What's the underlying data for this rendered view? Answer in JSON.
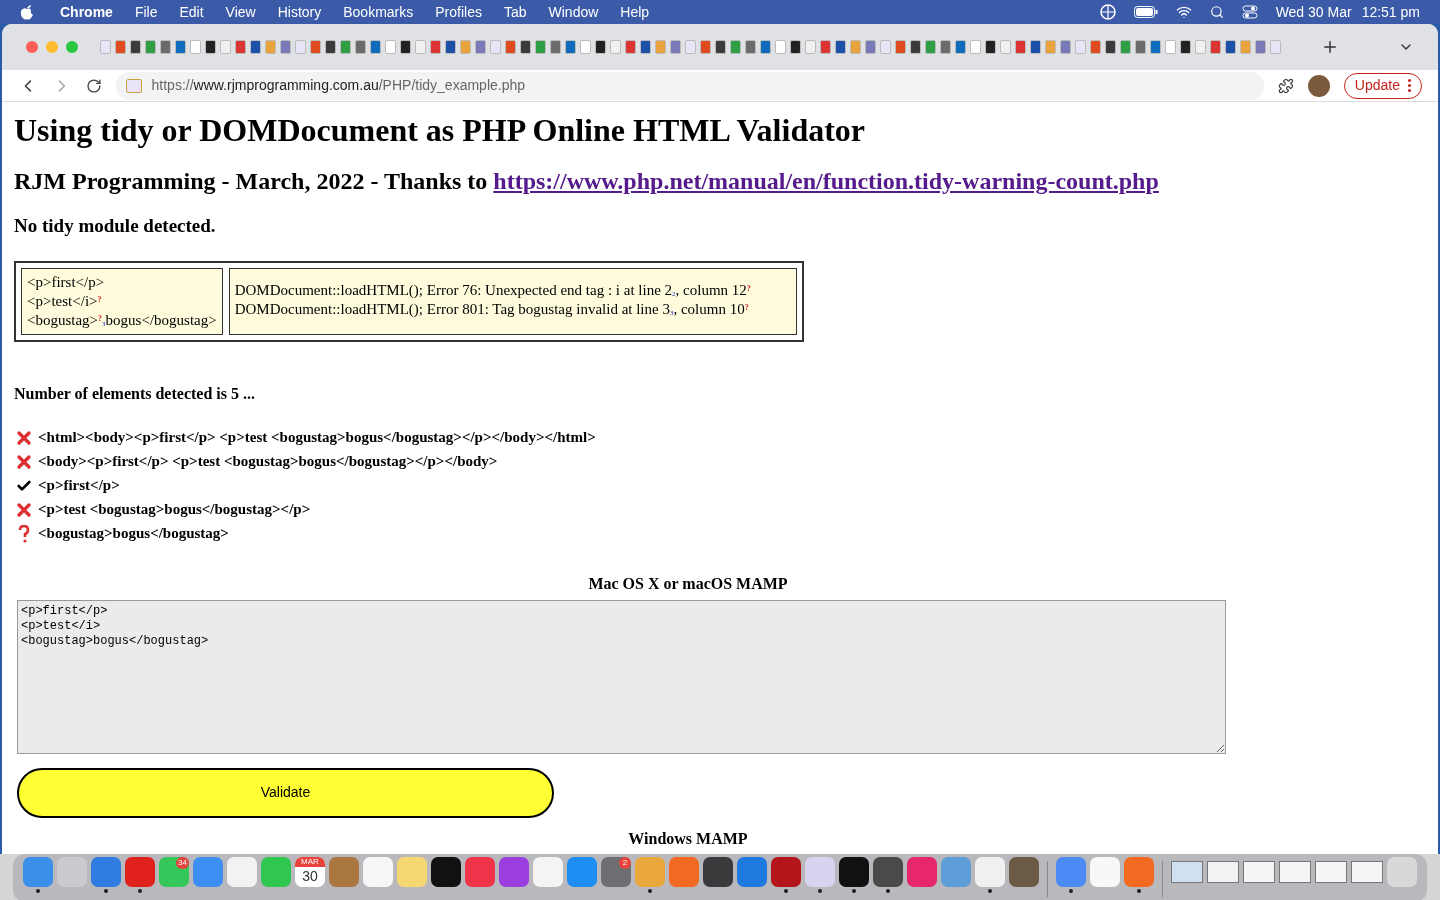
{
  "menu_bar": {
    "app": "Chrome",
    "menus": [
      "File",
      "Edit",
      "View",
      "History",
      "Bookmarks",
      "Profiles",
      "Tab",
      "Window",
      "Help"
    ],
    "date": "Wed 30 Mar",
    "time": "12:51 pm"
  },
  "address_bar": {
    "scheme": "https://",
    "host": "www.rjmprogramming.com.au",
    "path": "/PHP/tidy_example.php"
  },
  "update_button": "Update",
  "page": {
    "title": "Using tidy or DOMDocument as PHP Online HTML Validator",
    "subtitle": "RJM Programming - March, 2022 - Thanks to ",
    "subtitle_link": "https://www.php.net/manual/en/function.tidy-warning-count.php",
    "notice": "No tidy module detected.",
    "source_lines": [
      [
        {
          "kind": "text",
          "t": "<p>first</p>"
        }
      ],
      [
        {
          "kind": "text",
          "t": "<p>test</i>"
        },
        {
          "kind": "sup",
          "t": "?"
        }
      ],
      [
        {
          "kind": "text",
          "t": "<bogustag>"
        },
        {
          "kind": "sup",
          "t": "?"
        },
        {
          "kind": "sub",
          "t": "3"
        },
        {
          "kind": "text",
          "t": "bogus</bogustag>"
        }
      ]
    ],
    "error_lines": [
      [
        {
          "kind": "text",
          "t": "DOMDocument::loadHTML(); Error 76: Unexpected end tag : i at line 2"
        },
        {
          "kind": "sub",
          "t": "2"
        },
        {
          "kind": "text",
          "t": ", column 12"
        },
        {
          "kind": "sup",
          "t": "?"
        }
      ],
      [
        {
          "kind": "text",
          "t": "DOMDocument::loadHTML(); Error 801: Tag bogustag invalid at line 3"
        },
        {
          "kind": "sub",
          "t": "3"
        },
        {
          "kind": "text",
          "t": ", column 10"
        },
        {
          "kind": "sup",
          "t": "?"
        }
      ]
    ],
    "count": "Number of elements detected is 5 ...",
    "results": [
      {
        "kind": "fail",
        "text": "<html><body><p>first</p> <p>test <bogustag>bogus</bogustag></p></body></html>"
      },
      {
        "kind": "fail",
        "text": "<body><p>first</p> <p>test <bogustag>bogus</bogustag></p></body>"
      },
      {
        "kind": "pass",
        "text": "<p>first</p>"
      },
      {
        "kind": "fail",
        "text": "<p>test <bogustag>bogus</bogustag></p>"
      },
      {
        "kind": "unknown",
        "text": "<bogustag>bogus</bogustag>"
      }
    ],
    "section": "Mac OS X or macOS MAMP",
    "textarea": "<p>first</p>\n<p>test</i>\n<bogustag>bogus</bogustag>",
    "validate": "Validate",
    "next_section": "Windows MAMP"
  },
  "dock": [
    {
      "kind": "app",
      "color": "#3b8fe8",
      "running": true
    },
    {
      "kind": "app",
      "color": "#c9c9cf",
      "running": false
    },
    {
      "kind": "app",
      "color": "#2f7de0",
      "running": true
    },
    {
      "kind": "app",
      "color": "#e0201c",
      "running": true
    },
    {
      "kind": "app",
      "color": "#34c759",
      "running": false,
      "badge": "34"
    },
    {
      "kind": "app",
      "color": "#3d8ef5",
      "running": false
    },
    {
      "kind": "app",
      "color": "#f2f2f2",
      "running": false
    },
    {
      "kind": "app",
      "color": "#2fc74f",
      "running": false
    },
    {
      "kind": "calendar",
      "month": "MAR",
      "day": "30",
      "running": false
    },
    {
      "kind": "app",
      "color": "#a9773f",
      "running": false
    },
    {
      "kind": "app",
      "color": "#f7f7f7",
      "running": false
    },
    {
      "kind": "app",
      "color": "#f5d770",
      "running": false
    },
    {
      "kind": "app",
      "color": "#111111",
      "running": false
    },
    {
      "kind": "app",
      "color": "#f0354a",
      "running": false
    },
    {
      "kind": "app",
      "color": "#9a3ee0",
      "running": false
    },
    {
      "kind": "app",
      "color": "#f4f4f4",
      "running": false
    },
    {
      "kind": "app",
      "color": "#1d8ff2",
      "running": false
    },
    {
      "kind": "app",
      "color": "#6e6e73",
      "running": false,
      "badge": "2"
    },
    {
      "kind": "app",
      "color": "#e9a73c",
      "running": true
    },
    {
      "kind": "app",
      "color": "#f26a21",
      "running": false
    },
    {
      "kind": "app",
      "color": "#3a3a3c",
      "running": false
    },
    {
      "kind": "app",
      "color": "#1f7ae0",
      "running": false
    },
    {
      "kind": "app",
      "color": "#b3151b",
      "running": true
    },
    {
      "kind": "app",
      "color": "#d9d3f0",
      "running": true
    },
    {
      "kind": "app",
      "color": "#111111",
      "running": true
    },
    {
      "kind": "app",
      "color": "#4a4a4a",
      "running": true
    },
    {
      "kind": "app",
      "color": "#e8266b",
      "running": false
    },
    {
      "kind": "app",
      "color": "#5d9ed8",
      "running": false
    },
    {
      "kind": "app",
      "color": "#f0f0f0",
      "running": true
    },
    {
      "kind": "app",
      "color": "#6b5b45",
      "running": false
    },
    {
      "kind": "separator"
    },
    {
      "kind": "app",
      "color": "#4c8bf5",
      "running": true
    },
    {
      "kind": "app",
      "color": "#f8f8f8",
      "running": false
    },
    {
      "kind": "app",
      "color": "#f26a21",
      "running": true
    },
    {
      "kind": "separator"
    },
    {
      "kind": "window",
      "color": "#cfe0f2",
      "running": false
    },
    {
      "kind": "window",
      "color": "#f2f2f2",
      "running": false
    },
    {
      "kind": "window",
      "color": "#f5f5f5",
      "running": false
    },
    {
      "kind": "window",
      "color": "#f5f5f5",
      "running": false
    },
    {
      "kind": "window",
      "color": "#f5f5f5",
      "running": false
    },
    {
      "kind": "window",
      "color": "#f5f5f5",
      "running": false
    },
    {
      "kind": "app",
      "color": "#d8d8d8",
      "running": false
    }
  ]
}
